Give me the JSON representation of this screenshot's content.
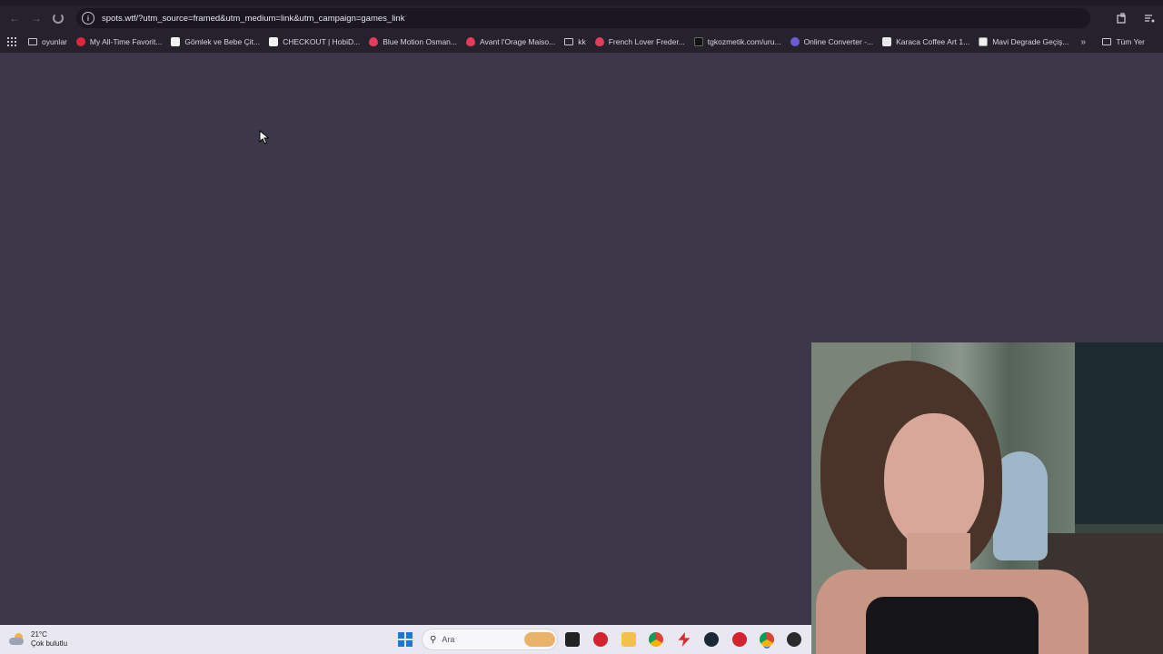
{
  "browser": {
    "url": "spots.wtf/?utm_source=framed&utm_medium=link&utm_campaign=games_link",
    "nav": {
      "back_icon": "back-arrow-icon",
      "forward_icon": "forward-arrow-icon"
    },
    "bookmarks": [
      {
        "label": "oyunlar",
        "icon": "folder"
      },
      {
        "label": "My All-Time Favorit...",
        "icon": "red"
      },
      {
        "label": "Gömlek ve Bebe Çit...",
        "icon": "white"
      },
      {
        "label": "CHECKOUT | HobiD...",
        "icon": "white"
      },
      {
        "label": "Blue Motion Osman...",
        "icon": "heart"
      },
      {
        "label": "Avant l'Orage Maiso...",
        "icon": "heart"
      },
      {
        "label": "kk",
        "icon": "folder"
      },
      {
        "label": "French Lover Freder...",
        "icon": "heart"
      },
      {
        "label": "tgkozmetik.com/uru...",
        "icon": "dark"
      },
      {
        "label": "Online Converter -...",
        "icon": "circle"
      },
      {
        "label": "Karaca Coffee Art 1...",
        "icon": "coffee"
      },
      {
        "label": "Mavi Degrade Geçiş...",
        "icon": "mavi"
      }
    ],
    "more_label": "»",
    "all_bookmarks_label": "Tüm Yer"
  },
  "taskbar": {
    "weather_temp": "21°C",
    "weather_desc": "Çok bulutlu",
    "search_placeholder": "Ara"
  }
}
